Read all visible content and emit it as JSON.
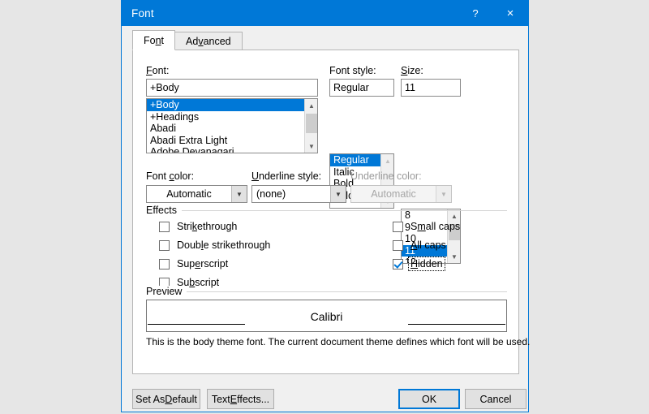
{
  "window": {
    "title": "Font",
    "help_label": "?",
    "close_label": "×"
  },
  "tabs": [
    {
      "label_pre": "Fo",
      "label_acc": "n",
      "label_post": "t",
      "active": true
    },
    {
      "label_pre": "Ad",
      "label_acc": "v",
      "label_post": "anced",
      "active": false
    }
  ],
  "font_section": {
    "font_label_pre": "",
    "font_label_acc": "F",
    "font_label_post": "ont:",
    "font_value": "+Body",
    "font_items": [
      "+Body",
      "+Headings",
      "Abadi",
      "Abadi Extra Light",
      "Adobe Devanagari"
    ],
    "font_selected_index": 0,
    "style_label": "Font style:",
    "style_value": "Regular",
    "style_items": [
      "Regular",
      "Italic",
      "Bold",
      "Bold Italic"
    ],
    "style_selected_index": 0,
    "size_label_acc": "S",
    "size_label_post": "ize:",
    "size_value": "11",
    "size_items": [
      "8",
      "9",
      "10",
      "11",
      "12"
    ],
    "size_selected_index": 3
  },
  "color_row": {
    "font_color_label_pre": "Font ",
    "font_color_label_acc": "c",
    "font_color_label_post": "olor:",
    "font_color_value": "Automatic",
    "underline_style_label_acc": "U",
    "underline_style_label_post": "nderline style:",
    "underline_style_value": "(none)",
    "underline_color_label": "Underline color:",
    "underline_color_value": "Automatic",
    "underline_color_disabled": true
  },
  "effects": {
    "group_title": "Effects",
    "left": [
      {
        "pre": "Stri",
        "acc": "k",
        "post": "ethrough",
        "checked": false
      },
      {
        "pre": "Doub",
        "acc": "l",
        "post": "e strikethrough",
        "checked": false
      },
      {
        "pre": "Sup",
        "acc": "e",
        "post": "rscript",
        "checked": false
      },
      {
        "pre": "Su",
        "acc": "b",
        "post": "script",
        "checked": false
      }
    ],
    "right": [
      {
        "pre": "S",
        "acc": "m",
        "post": "all caps",
        "checked": false,
        "focused": false
      },
      {
        "pre": "",
        "acc": "A",
        "post": "ll caps",
        "checked": false,
        "focused": false
      },
      {
        "pre": "",
        "acc": "H",
        "post": "idden",
        "checked": true,
        "focused": true
      }
    ]
  },
  "preview": {
    "group_title": "Preview",
    "sample_text": "Calibri",
    "description": "This is the body theme font. The current document theme defines which font will be used."
  },
  "footer": {
    "set_default_pre": "Set As ",
    "set_default_acc": "D",
    "set_default_post": "efault",
    "text_effects_pre": "Text ",
    "text_effects_acc": "E",
    "text_effects_post": "ffects...",
    "ok_label": "OK",
    "cancel_label": "Cancel"
  },
  "colors": {
    "accent": "#0078d7",
    "dialog_bg": "#f0f0f0",
    "desktop_bg": "#e6e6e6"
  }
}
